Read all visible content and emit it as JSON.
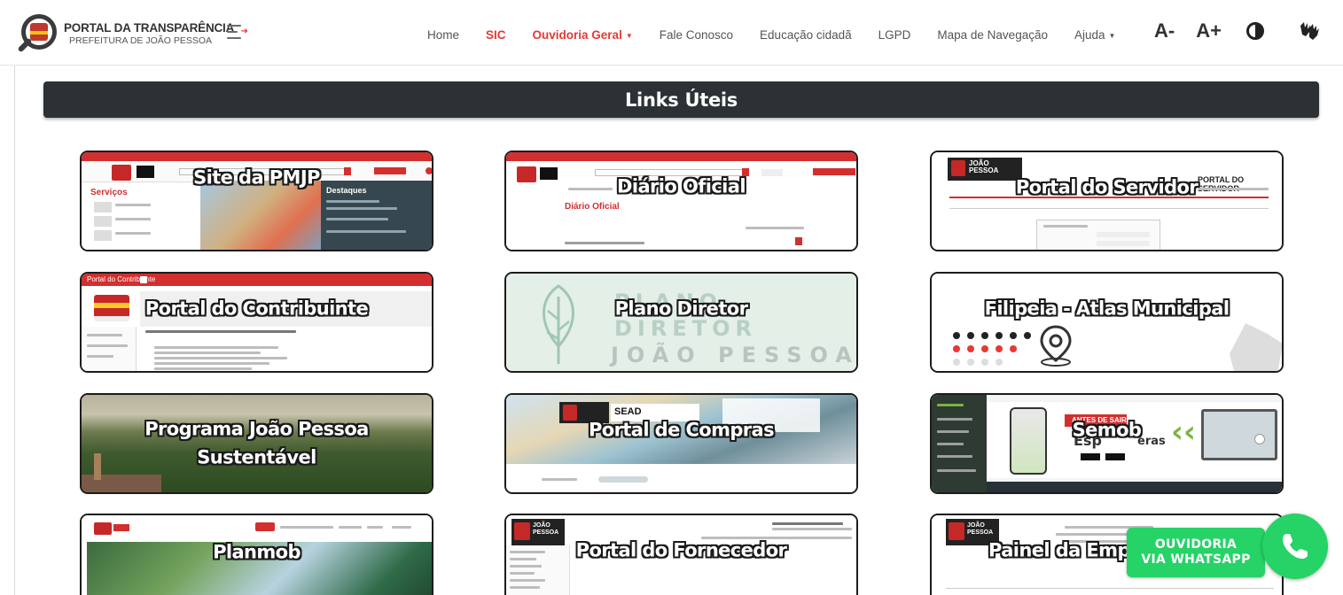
{
  "header": {
    "logo_title": "PORTAL DA TRANSPARÊNCIA",
    "logo_subtitle": "PREFEITURA DE JOÃO PESSOA",
    "nav": {
      "home": "Home",
      "sic": "SIC",
      "ouvidoria": "Ouvidoria Geral",
      "fale": "Fale Conosco",
      "educacao": "Educação cidadã",
      "lgpd": "LGPD",
      "mapa": "Mapa de Navegação",
      "ajuda": "Ajuda"
    },
    "tools": {
      "font_decrease": "A-",
      "font_increase": "A+"
    }
  },
  "page": {
    "title": "Links Úteis"
  },
  "cards": {
    "c1": "Site da PMJP",
    "c2": "Diário Oficial",
    "c3": "Portal do Servidor",
    "c4": "Portal do Contribuinte",
    "c5": "Plano Diretor",
    "c6": "Filipeia - Atlas Municipal",
    "c7a": "Programa João Pessoa",
    "c7b": "Sustentável",
    "c8": "Portal de Compras",
    "c9": "Semob",
    "c10": "Planmob",
    "c11": "Portal do Fornecedor",
    "c12": "Painel da Empre"
  },
  "card_inner": {
    "c1_services": "Serviços",
    "c1_destaques": "Destaques",
    "c2_heading": "Diário Oficial",
    "c3_banner": "PORTAL DO SERVIDOR",
    "c3_city": "JOÃO PESSOA",
    "c4_bar": "Portal do Contribuinte",
    "c5_plano": "PLANO",
    "c5_diretor": "DIRETOR",
    "c5_city": "JOÃO PESSOA",
    "c8_sead": "SEAD",
    "c9_banner": "ANTES DE SAIR",
    "c9_esp": "Esp",
    "c9_eras": "eras",
    "c11_city": "JOÃO PESSOA",
    "c12_city": "JOÃO PESSOA"
  },
  "whatsapp": {
    "line1": "OUVIDORIA",
    "line2": "VIA WHATSAPP"
  },
  "colors": {
    "accent_red": "#e53935",
    "title_bar": "#2b3134",
    "whatsapp_green": "#25d366"
  },
  "icons": {
    "menu": "menu-toggle-icon",
    "contrast": "contrast-icon",
    "libras": "sign-language-icon",
    "whatsapp": "whatsapp-icon"
  }
}
